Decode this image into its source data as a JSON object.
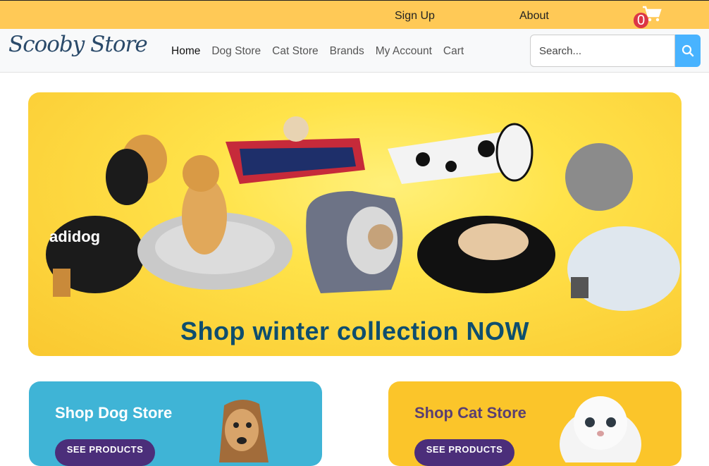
{
  "topbar": {
    "signup": "Sign Up",
    "about": "About",
    "cart_count": "0"
  },
  "nav": {
    "logo": "Scooby Store",
    "items": [
      {
        "label": "Home",
        "active": true
      },
      {
        "label": "Dog Store"
      },
      {
        "label": "Cat Store"
      },
      {
        "label": "Brands"
      },
      {
        "label": "My Account"
      },
      {
        "label": "Cart"
      }
    ],
    "search_placeholder": "Search..."
  },
  "hero": {
    "title": "Shop winter collection NOW"
  },
  "cards": {
    "dog": {
      "title": "Shop Dog Store",
      "button": "SEE PRODUCTS"
    },
    "cat": {
      "title": "Shop Cat Store",
      "button": "SEE PRODUCTS"
    }
  },
  "colors": {
    "topbar": "#ffc956",
    "search_button": "#48b3ff",
    "dog_card": "#3fb4d6",
    "cat_card": "#fbc52a",
    "button": "#4b2e7a",
    "hero_title": "#0e4e6e"
  }
}
